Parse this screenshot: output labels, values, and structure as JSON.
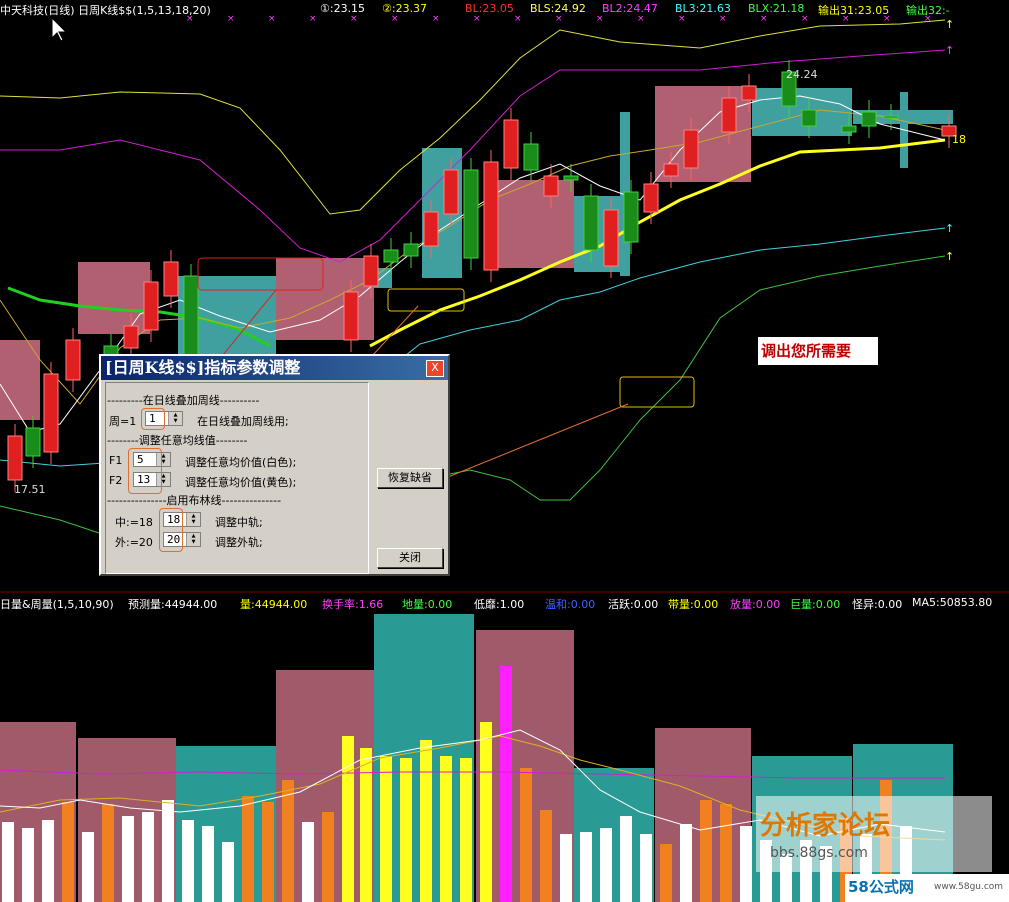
{
  "header": {
    "title": "中天科技(日线) 日周K线$$(1,5,13,18,20)",
    "items": [
      {
        "text": "①:23.15",
        "color": "#ffffff"
      },
      {
        "text": "②:23.37",
        "color": "#ffff00"
      },
      {
        "text": "BL:23.05",
        "color": "#ff3030"
      },
      {
        "text": "BLS:24.92",
        "color": "#ffff60"
      },
      {
        "text": "BL2:24.47",
        "color": "#ff40ff"
      },
      {
        "text": "BL3:21.63",
        "color": "#40ffff"
      },
      {
        "text": "BLX:21.18",
        "color": "#40ff40"
      },
      {
        "text": "输出31:23.05",
        "color": "#ffff00"
      },
      {
        "text": "输出32:-",
        "color": "#40ff40"
      }
    ]
  },
  "price_chart": {
    "high_label": "24.24",
    "low_label": "17.51",
    "right_label": "18",
    "upper_arrows": [
      "↑",
      "↑"
    ],
    "lower_arrows": [
      "↑",
      "↑"
    ]
  },
  "volume_header": {
    "title": "日量&周量(1,5,10,90)",
    "items": [
      {
        "text": "预测量:44944.00",
        "color": "#ffffff"
      },
      {
        "text": "量:44944.00",
        "color": "#ffff00"
      },
      {
        "text": "换手率:1.66",
        "color": "#ff40ff"
      },
      {
        "text": "地量:0.00",
        "color": "#40ff40"
      },
      {
        "text": "低靡:1.00",
        "color": "#ffffff"
      },
      {
        "text": "温和:0.00",
        "color": "#4060ff"
      },
      {
        "text": "活跃:0.00",
        "color": "#ffffff"
      },
      {
        "text": "带量:0.00",
        "color": "#ffff00"
      },
      {
        "text": "放量:0.00",
        "color": "#ff40ff"
      },
      {
        "text": "巨量:0.00",
        "color": "#40ff40"
      },
      {
        "text": "怪异:0.00",
        "color": "#ffffff"
      },
      {
        "text": "MA5:50853.80",
        "color": "#ffffff"
      }
    ]
  },
  "dialog": {
    "title": "[日周K线$$]指标参数调整",
    "close": "X",
    "sec1": "---------在日线叠加周线----------",
    "p1_label": "周=1",
    "p1_value": "1",
    "p1_desc": "在日线叠加周线用;",
    "sec2": "--------调整任意均线值--------",
    "f1_label": "F1",
    "f1_value": "5",
    "f1_desc": "调整任意均价值(白色);",
    "f2_label": "F2",
    "f2_value": "13",
    "f2_desc": "调整任意均价值(黄色);",
    "sec3": "---------------启用布林线---------------",
    "mid_label": "中:=18",
    "mid_value": "18",
    "mid_desc": "调整中轨;",
    "out_label": "外:=20",
    "out_value": "20",
    "out_desc": "调整外轨;",
    "restore_btn": "恢复缺省",
    "close_btn": "关闭"
  },
  "annotation": {
    "hint": "调出您所需要"
  },
  "watermark": {
    "forum": "分析家论坛",
    "url": "bbs.88gs.com",
    "badge": "58公式网",
    "badge_url": "www.58gu.com"
  },
  "colors": {
    "up": "#e02020",
    "down": "#1a8c1a",
    "week_up": "#b06070",
    "week_down": "#40a0a0",
    "ma_white": "#ffffff",
    "ma_yellow": "#ffff00",
    "boll_yellow": "#e0e040",
    "boll_magenta": "#d020d0",
    "boll_cyan": "#40d0e0",
    "boll_green": "#40c040",
    "vol_mauve": "#a05a6a",
    "vol_teal": "#2a9a94",
    "orange_line": "#e06020"
  }
}
